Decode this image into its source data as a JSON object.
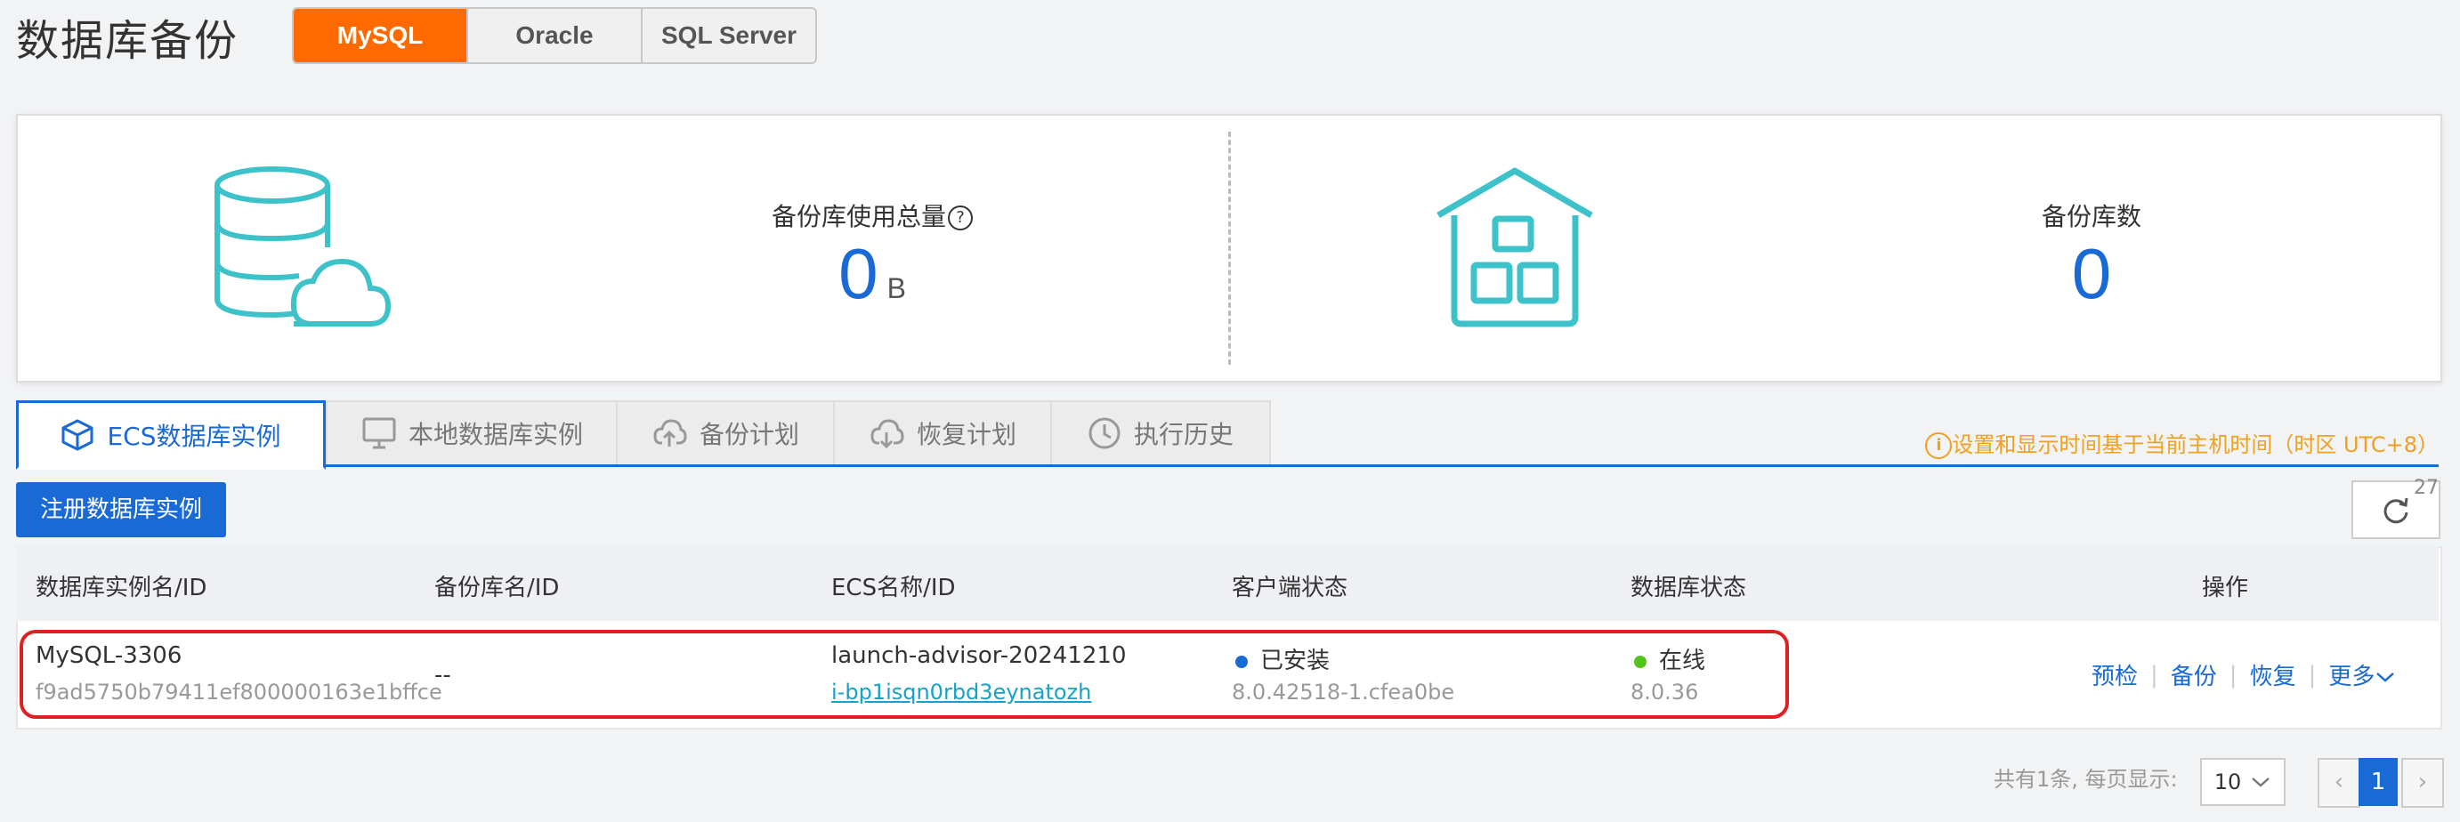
{
  "page_title": "数据库备份",
  "db_types": [
    "MySQL",
    "Oracle",
    "SQL Server"
  ],
  "stats": {
    "usage_label": "备份库使用总量",
    "usage_value": "0",
    "usage_unit": "B",
    "count_label": "备份库数",
    "count_value": "0"
  },
  "tabs": [
    {
      "label": "ECS数据库实例",
      "icon": "cube-icon"
    },
    {
      "label": "本地数据库实例",
      "icon": "monitor-icon"
    },
    {
      "label": "备份计划",
      "icon": "cloud-upload-icon"
    },
    {
      "label": "恢复计划",
      "icon": "cloud-download-icon"
    },
    {
      "label": "执行历史",
      "icon": "clock-icon"
    }
  ],
  "timezone_note": "设置和显示时间基于当前主机时间（时区 UTC+8）",
  "register_button": "注册数据库实例",
  "refresh_count": "27",
  "table": {
    "headers": [
      "数据库实例名/ID",
      "备份库名/ID",
      "ECS名称/ID",
      "客户端状态",
      "数据库状态",
      "操作"
    ],
    "rows": [
      {
        "instance_name": "MySQL-3306",
        "instance_id": "f9ad5750b79411ef800000163e1bffce",
        "backup_name": "--",
        "ecs_name": "launch-advisor-20241210",
        "ecs_id": "i-bp1isqn0rbd3eynatozh",
        "client_status": "已安装",
        "client_version": "8.0.42518-1.cfea0be",
        "client_status_color": "#1a6ad6",
        "db_status": "在线",
        "db_version": "8.0.36",
        "db_status_color": "#52c41a",
        "actions": [
          "预检",
          "备份",
          "恢复",
          "更多"
        ]
      }
    ]
  },
  "pagination": {
    "summary": "共有1条, 每页显示:",
    "page_size": "10",
    "current_page": "1"
  }
}
